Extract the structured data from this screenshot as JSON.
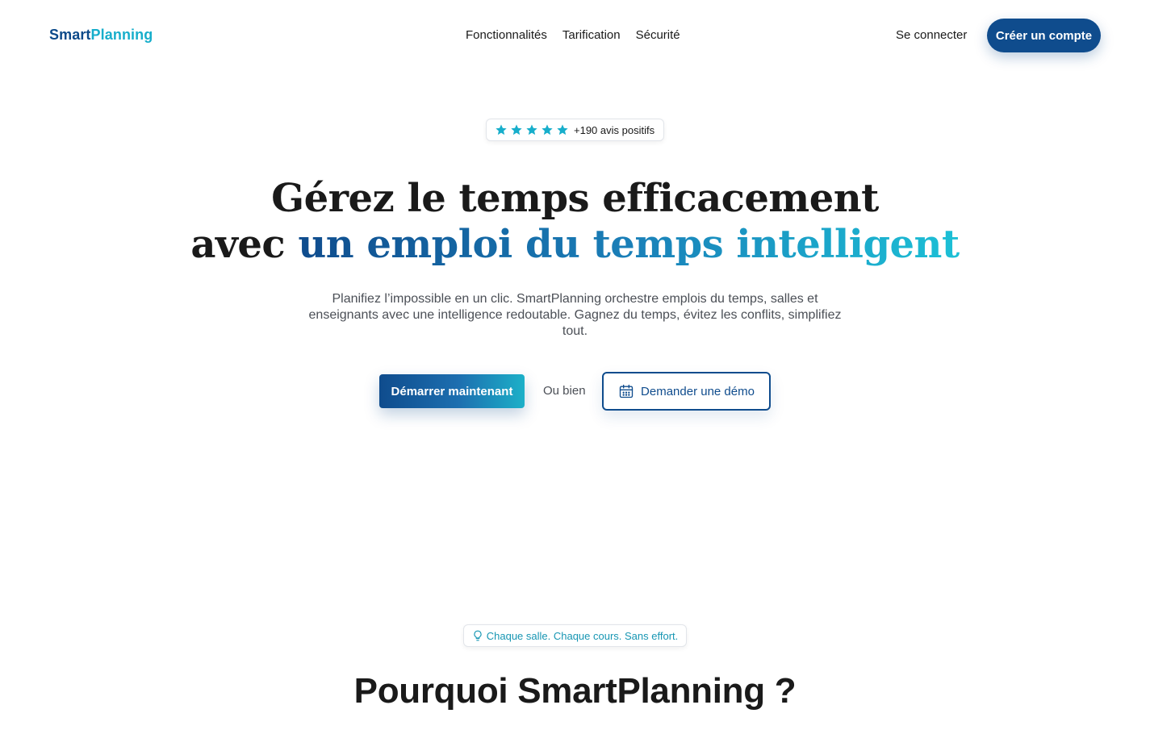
{
  "header": {
    "logo_part1": "Smart",
    "logo_part2": "Planning",
    "nav": [
      "Fonctionnalités",
      "Tarification",
      "Sécurité"
    ],
    "login": "Se connecter",
    "signup": "Créer un compte"
  },
  "hero": {
    "stars": 5,
    "rating_text": "+190 avis positifs",
    "title_line1": "Gérez le temps efficacement",
    "title_line2_prefix": "avec ",
    "title_line2_highlight": "un emploi du temps intelligent",
    "subtitle": "Planifiez l’impossible en un clic. SmartPlanning orchestre emplois du temps, salles et enseignants avec une intelligence redoutable. Gagnez du temps, évitez les conflits, simplifiez tout.",
    "cta_primary": "Démarrer maintenant",
    "or_text": "Ou bien",
    "cta_demo": "Demander une démo"
  },
  "section": {
    "tag": "Chaque salle. Chaque cours. Sans effort.",
    "title": "Pourquoi SmartPlanning ?"
  },
  "colors": {
    "brand_dark": "#0f4c8d",
    "brand_light": "#17aecb",
    "star": "#17aecb"
  },
  "icons": {
    "star": "star-icon",
    "calendar": "calendar-icon",
    "lightbulb": "lightbulb-icon"
  }
}
